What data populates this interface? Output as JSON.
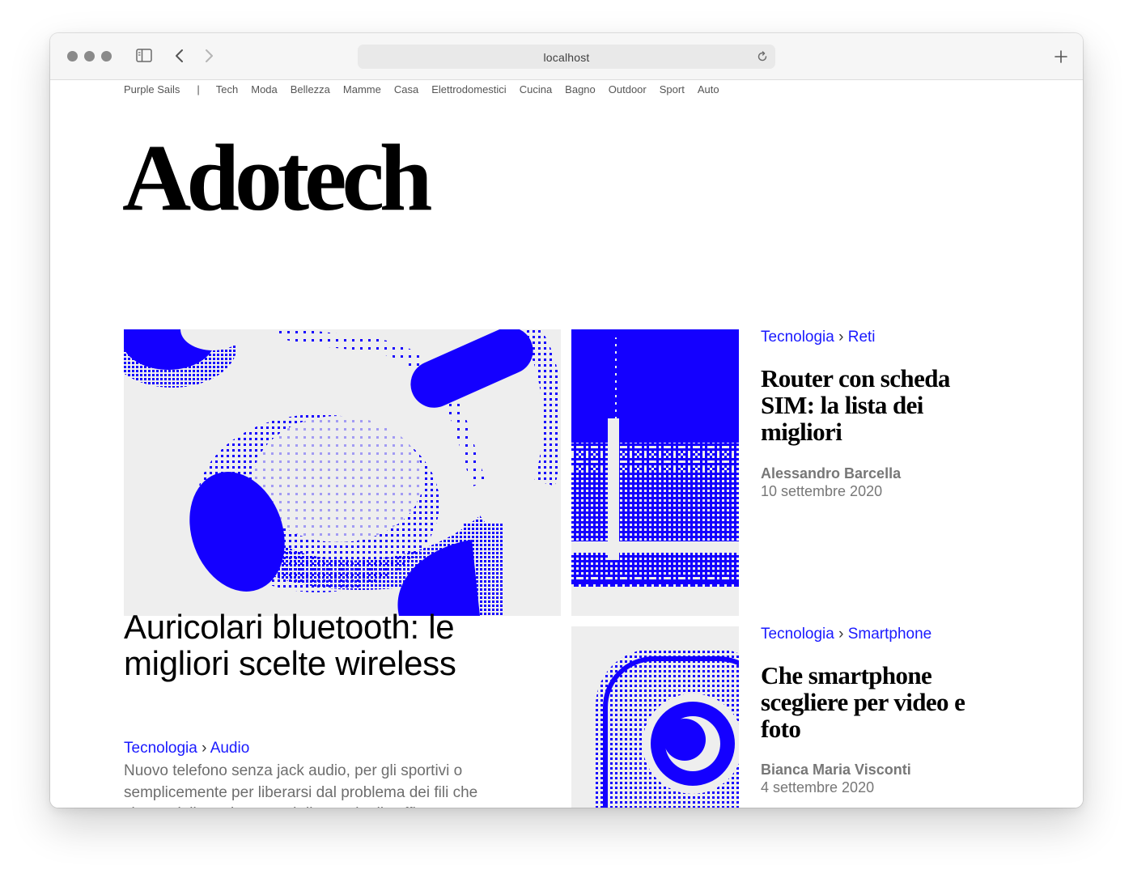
{
  "browser": {
    "url": "localhost"
  },
  "nav": {
    "brand": "Purple Sails",
    "separator": "|",
    "items": [
      "Tech",
      "Moda",
      "Bellezza",
      "Mamme",
      "Casa",
      "Elettrodomestici",
      "Cucina",
      "Bagno",
      "Outdoor",
      "Sport",
      "Auto"
    ]
  },
  "site": {
    "logo": "Adotech"
  },
  "featured": {
    "title": "Auricolari bluetooth: le migliori scelte wireless",
    "category": "Tecnologia",
    "subcategory": "Audio",
    "excerpt": "Nuovo telefono senza jack audio, per gli sportivi o semplicemente per liberarsi dal problema dei fili che si attorcigliano, i vantaggi di un paio di cuffi…"
  },
  "articles": [
    {
      "category": "Tecnologia",
      "subcategory": "Reti",
      "title": "Router con scheda SIM: la lista dei migliori",
      "author": "Alessandro Barcella",
      "date": "10 settembre 2020"
    },
    {
      "category": "Tecnologia",
      "subcategory": "Smartphone",
      "title": "Che smartphone scegliere per video e foto",
      "author": "Bianca Maria Visconti",
      "date": "4 settembre 2020"
    }
  ],
  "colors": {
    "accent": "#1a1aff",
    "illustration": "#1400ff",
    "image_bg": "#eeeeee"
  }
}
